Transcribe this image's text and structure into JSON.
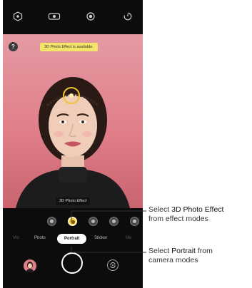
{
  "top_bar": {
    "icons": [
      "hexagon-settings-icon",
      "hdr-icon",
      "flash-icon",
      "timer-icon"
    ]
  },
  "preview": {
    "help_label": "?",
    "toast_text": "3D Photo Effect is available.",
    "effect_name_label": "3D Photo Effect"
  },
  "effects": {
    "count": 5,
    "selected_index": 1
  },
  "modes": {
    "items": [
      "Vlo",
      "Photo",
      "Portrait",
      "Sticker",
      "Mo"
    ],
    "selected": "Portrait"
  },
  "callouts": {
    "effect": {
      "prefix": "Select ",
      "highlight": "3D Photo Effect",
      "suffix": "from effect modes"
    },
    "mode": {
      "prefix": "Select ",
      "highlight": "Portrait",
      "mid": " from",
      "suffix": "camera modes"
    }
  },
  "colors": {
    "background": "#e07f8a",
    "highlight": "#f1c22d"
  }
}
